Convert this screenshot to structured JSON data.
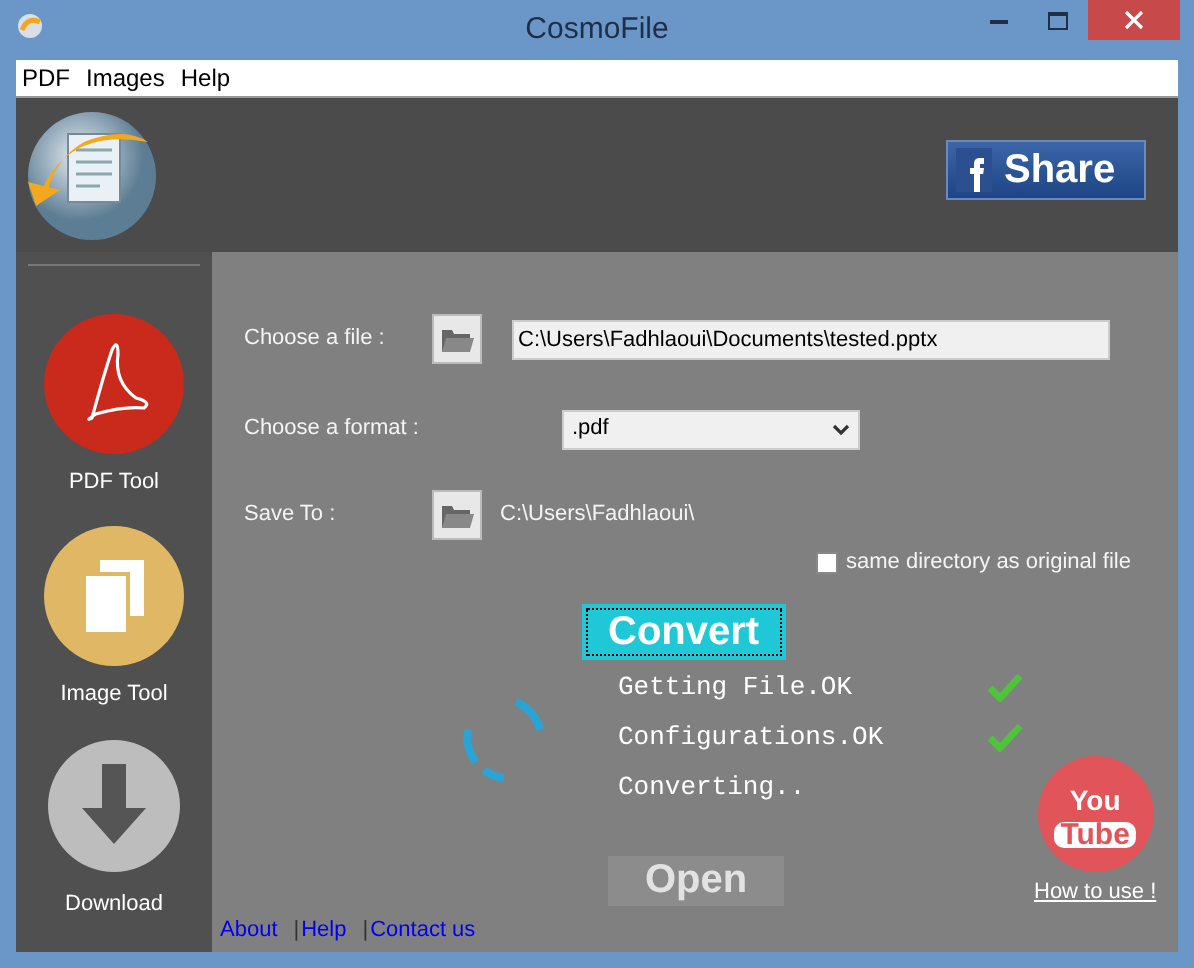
{
  "window": {
    "title": "CosmoFile"
  },
  "menu": [
    "PDF",
    "Images",
    "Help"
  ],
  "header": {
    "share_button": "Share"
  },
  "sidebar": {
    "items": [
      {
        "label": "PDF Tool",
        "kind": "pdf"
      },
      {
        "label": "Image Tool",
        "kind": "image"
      },
      {
        "label": "Download",
        "kind": "download"
      }
    ]
  },
  "form": {
    "file_label": "Choose a file :",
    "file_value": "C:\\Users\\Fadhlaoui\\Documents\\tested.pptx",
    "format_label": "Choose a format :",
    "format_value": ".pdf",
    "save_label": "Save To :",
    "save_path": "C:\\Users\\Fadhlaoui\\",
    "same_dir": {
      "label": "same directory as original file",
      "checked": false
    }
  },
  "convert_button": "Convert",
  "status_lines": [
    {
      "text": "Getting File.OK",
      "done": true
    },
    {
      "text": "Configurations.OK",
      "done": true
    },
    {
      "text": "Converting..",
      "done": false
    }
  ],
  "open_button": {
    "label": "Open",
    "disabled": true
  },
  "youtube": {
    "logo_top": "You",
    "logo_bottom": "Tube",
    "link": "How to use !"
  },
  "footer_links": [
    {
      "text": "About"
    },
    {
      "text": "Help",
      "separator": "|"
    },
    {
      "text": "Contact us",
      "separator": "|"
    }
  ]
}
